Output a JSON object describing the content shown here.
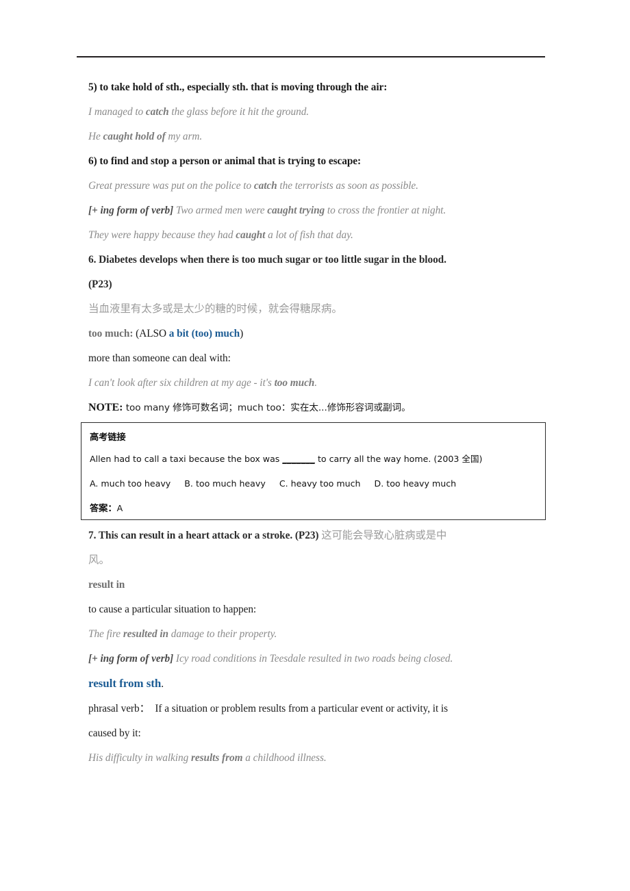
{
  "document": {
    "type": "study-notes-page",
    "language_mix": "English/Chinese",
    "accent_blue": "#1c5c94",
    "example_gray": "#8a8a8a",
    "chinese_gray": "#9b9b9b"
  },
  "sections": {
    "sense5": {
      "definition": "5) to take hold of sth., especially sth. that is moving through the air:",
      "examples": [
        {
          "pre": "I managed to ",
          "bold": "catch",
          "post": " the glass before it hit the ground."
        },
        {
          "pre": "He ",
          "bold": "caught hold of",
          "post": " my arm."
        }
      ]
    },
    "sense6": {
      "definition": "6) to find and stop a person or animal that is trying to escape:",
      "examples": [
        {
          "pre": "Great pressure was put on the police to ",
          "bold": "catch",
          "post": " the terrorists as soon as possible."
        },
        {
          "bracket": "[+ ing form of verb]",
          "pre": " Two armed men were ",
          "bold": "caught trying",
          "post": " to cross the frontier at night."
        },
        {
          "pre": "They were happy because they had ",
          "bold": "caught",
          "post": " a lot of fish that day."
        }
      ]
    },
    "item6": {
      "heading_line1": "6. Diabetes develops when there is too much sugar or too little sugar in the blood.",
      "heading_line2": "(P23)",
      "translation": "当血液里有太多或是太少的糖的时候，就会得糖尿病。",
      "entry_head_gray": "too much:",
      "entry_head_also": " (ALSO ",
      "entry_head_blue": "a bit (too) much",
      "entry_head_close": ")",
      "definition": "more than someone can deal with:",
      "example": {
        "pre": "I can't look after six children at my age - it's ",
        "bold": "too much",
        "post": "."
      },
      "note_label": "NOTE:",
      "note_text": " too many 修饰可数名词；much too：实在太...修饰形容词或副词。"
    },
    "exercise_box": {
      "title": "高考链接",
      "question": "Allen had to call a taxi because the box was ",
      "blank": "_______",
      "question_tail": " to carry all the way home. (2003 全国)",
      "options": [
        "A. much too heavy",
        "B. too much heavy",
        "C. heavy too much",
        "D. too heavy much"
      ],
      "answer_label": "答案：",
      "answer_value": "A"
    },
    "item7": {
      "heading_en": "7. This can result in a heart attack or a stroke. (P23)",
      "heading_cn_line1": " 这可能会导致心脏病或是中",
      "heading_cn_line2": "风。",
      "entry_head": "result in",
      "definition": "to cause a particular situation to happen:",
      "examples": [
        {
          "pre": "The fire ",
          "bold": "resulted in",
          "post": " damage to their property."
        },
        {
          "bracket": "[+ ing form of verb]",
          "pre": " Icy road conditions in Teesdale resulted in two roads being closed.",
          "bold": "",
          "post": ""
        }
      ],
      "phrase_head_blue": "result from sth",
      "phrase_head_period": ".",
      "phrasal_label": "phrasal verb：",
      "phrasal_def_line1": "  If a situation or problem results from a particular event or activity, it is",
      "phrasal_def_line2": "caused by it:",
      "phrasal_example": {
        "pre": "His difficulty in walking ",
        "bold": "results from",
        "post": " a childhood illness."
      }
    }
  }
}
